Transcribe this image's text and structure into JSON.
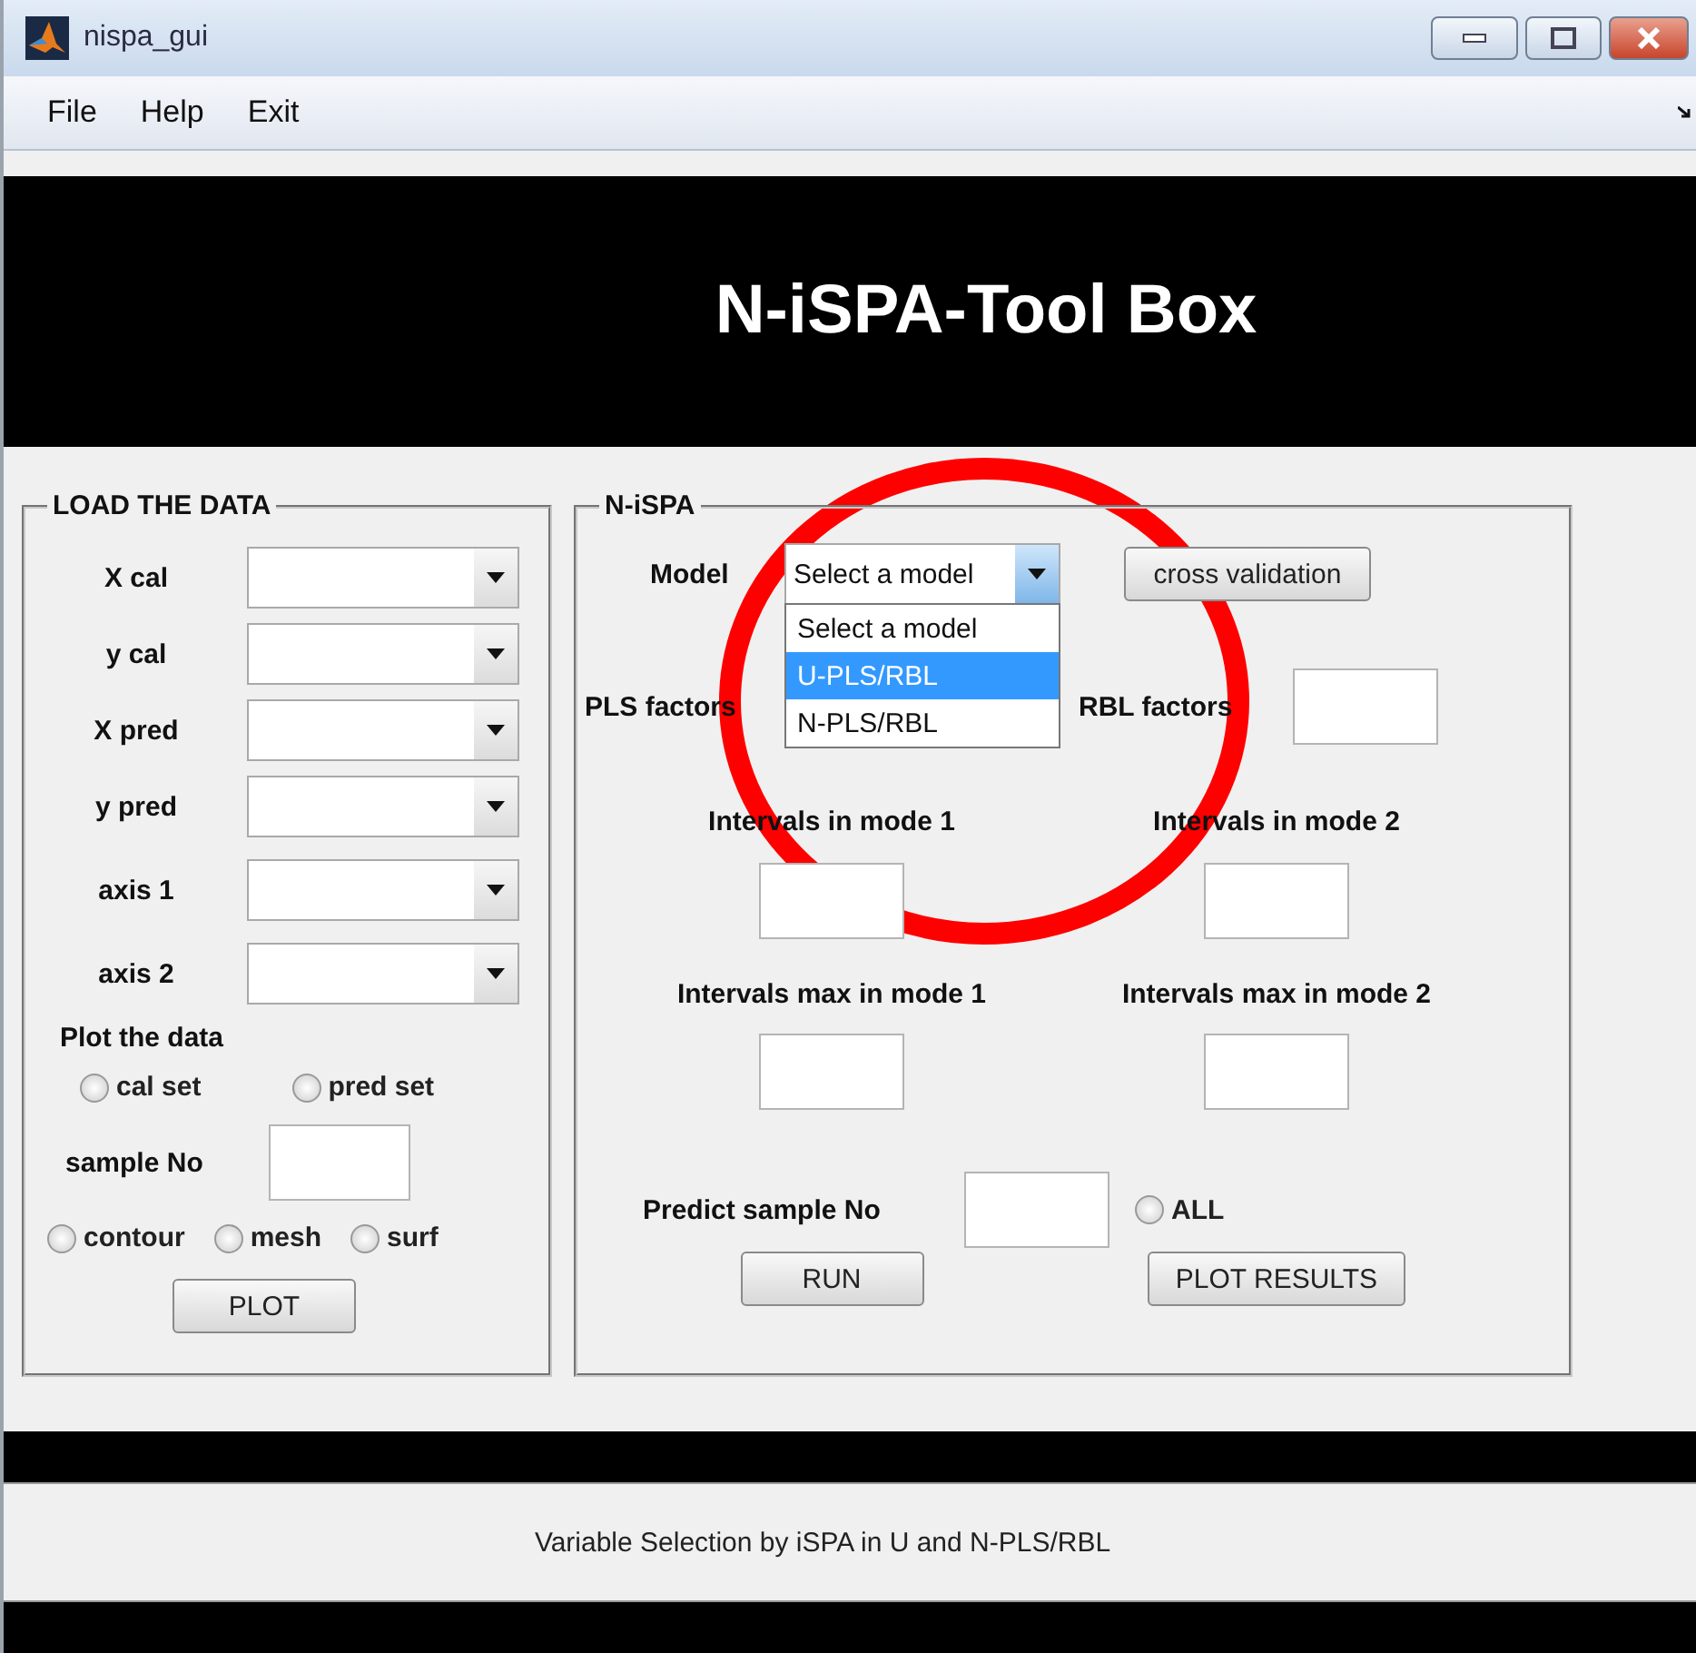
{
  "window": {
    "title": "nispa_gui"
  },
  "menu": [
    {
      "label": "File"
    },
    {
      "label": "Help"
    },
    {
      "label": "Exit"
    }
  ],
  "banner": {
    "title": "N-iSPA-Tool Box"
  },
  "load_panel": {
    "title": "LOAD THE DATA",
    "dropdowns": [
      {
        "label": "X cal"
      },
      {
        "label": "y cal"
      },
      {
        "label": "X pred"
      },
      {
        "label": "y pred"
      },
      {
        "label": "axis 1"
      },
      {
        "label": "axis 2"
      }
    ],
    "plot_label": "Plot the data",
    "set_options": [
      {
        "label": "cal set",
        "selected": false
      },
      {
        "label": "pred set",
        "selected": false
      }
    ],
    "sample_label": "sample No",
    "plot_types": [
      {
        "label": "contour",
        "selected": false
      },
      {
        "label": "mesh",
        "selected": false
      },
      {
        "label": "surf",
        "selected": false
      }
    ],
    "plot_button": "PLOT"
  },
  "nispa_panel": {
    "title": "N-iSPA",
    "model": {
      "label": "Model",
      "value": "Select a model",
      "expanded": true,
      "options": [
        {
          "label": "Select a model",
          "highlighted": false
        },
        {
          "label": "U-PLS/RBL",
          "highlighted": true
        },
        {
          "label": "N-PLS/RBL",
          "highlighted": false
        }
      ]
    },
    "cross_validation_button": "cross validation",
    "pls_factors_label": "PLS factors",
    "rbl_factors_label": "RBL factors",
    "intervals": [
      {
        "label": "Intervals in mode 1"
      },
      {
        "label": "Intervals in mode 2"
      }
    ],
    "intervals_max": [
      {
        "label": "Intervals max in mode 1"
      },
      {
        "label": "Intervals max in mode 2"
      }
    ],
    "predict": {
      "label": "Predict sample No",
      "all": {
        "label": "ALL",
        "selected": false
      }
    },
    "run_button": "RUN",
    "plot_results_button": "PLOT RESULTS"
  },
  "status": {
    "text": "Variable Selection by iSPA in U and N-PLS/RBL"
  },
  "annotation": {
    "kind": "circle"
  }
}
